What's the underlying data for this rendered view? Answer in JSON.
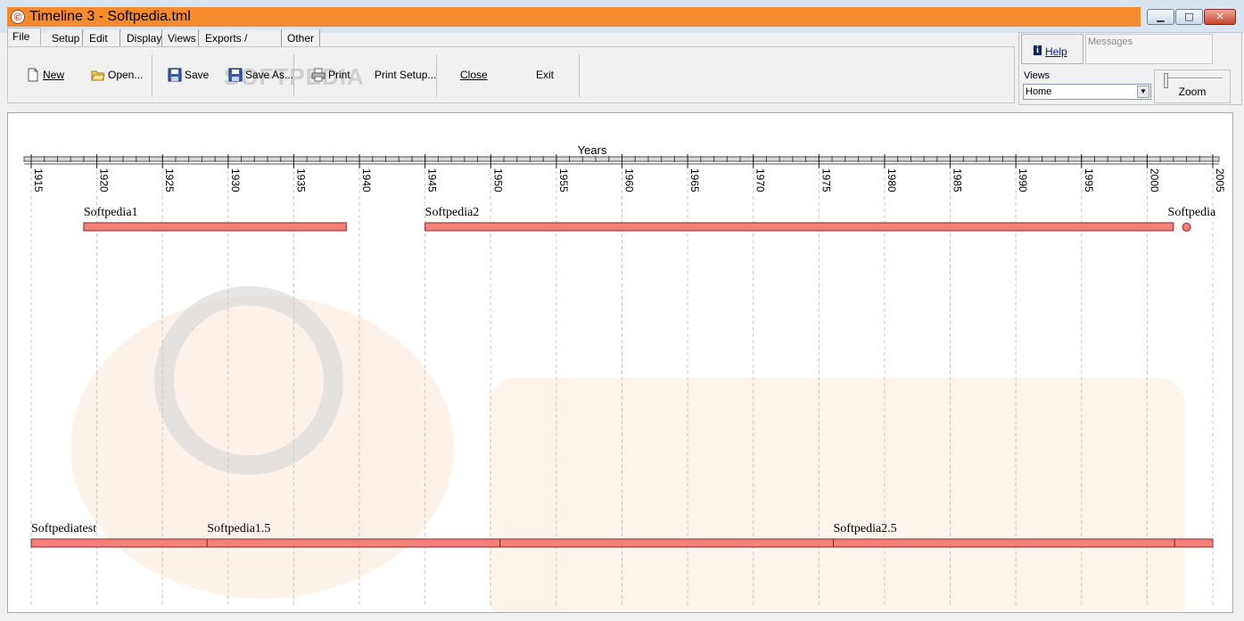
{
  "window": {
    "title": "Timeline 3 - Softpedia.tml",
    "app_icon": "©"
  },
  "window_buttons": {
    "minimize": "▁",
    "maximize": "□",
    "close": "✕"
  },
  "tabs": [
    "File",
    "Setup",
    "Edit",
    "Display",
    "Views",
    "Exports / Imports",
    "Other"
  ],
  "active_tab": "File",
  "ribbon": {
    "new": "New",
    "open": "Open...",
    "save": "Save",
    "save_as": "Save As...",
    "print": "Print",
    "print_setup": "Print Setup...",
    "close": "Close",
    "exit": "Exit"
  },
  "watermark": "SOFTPEDIA",
  "help": {
    "label": "Help"
  },
  "messages": {
    "label": "Messages"
  },
  "views": {
    "label": "Views",
    "selected": "Home"
  },
  "zoom": {
    "label": "Zoom",
    "level": 0
  },
  "chart_data": {
    "type": "timeline",
    "axis_title": "Years",
    "x_range": [
      1915,
      2005
    ],
    "ticks": [
      1915,
      1920,
      1925,
      1930,
      1935,
      1940,
      1945,
      1950,
      1955,
      1960,
      1965,
      1970,
      1975,
      1980,
      1985,
      1990,
      1995,
      2000,
      2005
    ],
    "grid": true,
    "events": [
      {
        "label": "Softpedia1",
        "start": 1919,
        "end": 1939,
        "lane": 1
      },
      {
        "label": "Softpedia2",
        "start": 1945,
        "end": 2002,
        "lane": 1
      },
      {
        "label": "Softpedia",
        "start": 2003,
        "end": 2003,
        "lane": 1,
        "point": true
      },
      {
        "label": "Softpediatest",
        "start": 1915,
        "end": 1928.4,
        "lane": 2
      },
      {
        "label": "Softpedia1.5",
        "start": 1928.4,
        "end": 1950.7,
        "lane": 2
      },
      {
        "label": "",
        "start": 1950.7,
        "end": 1976.1,
        "lane": 2
      },
      {
        "label": "Softpedia2.5",
        "start": 1976.1,
        "end": 2002.1,
        "lane": 2
      },
      {
        "label": "",
        "start": 2002.1,
        "end": 2005,
        "lane": 2
      }
    ],
    "colors": {
      "bar": "#f4807a",
      "bar_border": "#8a2a2a",
      "grid": "#c8c8c8"
    }
  }
}
